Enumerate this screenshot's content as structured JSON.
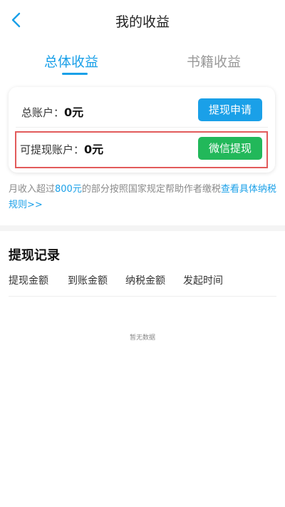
{
  "nav": {
    "title": "我的收益"
  },
  "tabs": [
    {
      "label": "总体收益",
      "active": true
    },
    {
      "label": "书籍收益",
      "active": false
    }
  ],
  "accounts": {
    "total_label": "总账户：",
    "total_value": "0元",
    "apply_button": "提现申请",
    "withdrawable_label": "可提现账户：",
    "withdrawable_value": "0元",
    "wechat_button": "微信提现"
  },
  "notice": {
    "prefix": "月收入超过",
    "amount": "800元",
    "middle": "的部分按照国家规定帮助作者缴税",
    "link": "查看具体纳税规则>>"
  },
  "records": {
    "title": "提现记录",
    "columns": [
      "提现金额",
      "到账金额",
      "纳税金额",
      "发起时间"
    ],
    "empty_text": "暂无数据"
  },
  "colors": {
    "accent": "#1aa0e8",
    "wechat_green": "#22b85a",
    "highlight_red": "#e25b5b"
  }
}
